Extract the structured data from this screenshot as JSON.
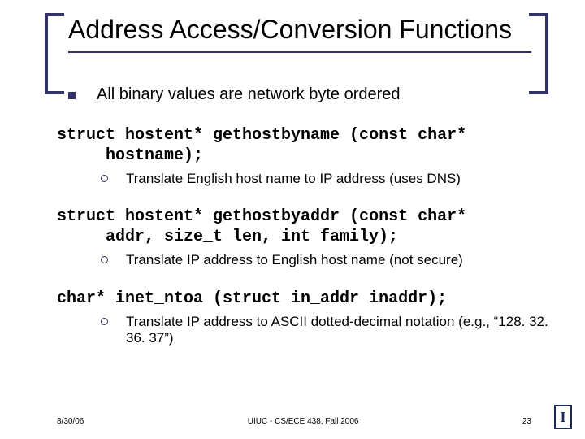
{
  "title": "Address Access/Conversion Functions",
  "bullets": {
    "intro": "All binary values are network byte ordered",
    "func1": {
      "code_line1": "struct hostent* gethostbyname (const char*",
      "code_line2": "hostname);",
      "desc": "Translate English host name to IP address (uses DNS)"
    },
    "func2": {
      "code_line1": "struct hostent* gethostbyaddr (const char*",
      "code_line2": "addr, size_t len, int family);",
      "desc": "Translate IP address to English host name (not secure)"
    },
    "func3": {
      "code_line1": "char* inet_ntoa (struct in_addr inaddr);",
      "desc": "Translate IP address to ASCII dotted-decimal notation (e.g., “128. 32. 36. 37”)"
    }
  },
  "footer": {
    "date": "8/30/06",
    "center": "UIUC - CS/ECE 438, Fall 2006",
    "page": "23"
  },
  "logo_letter": "I"
}
